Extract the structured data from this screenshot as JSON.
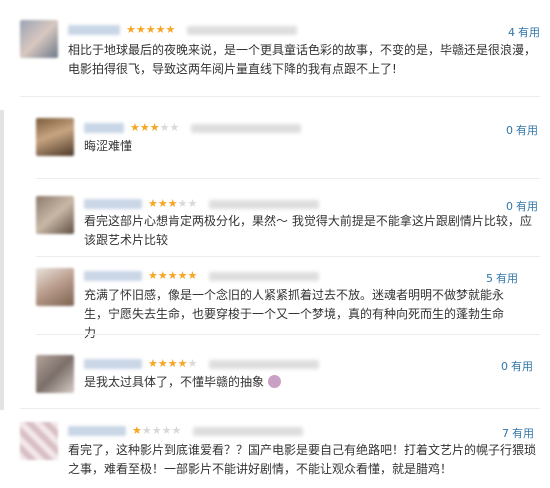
{
  "reviews": [
    {
      "stars": 5,
      "useful_count": "4",
      "useful_label": "有用",
      "text": "相比于地球最后的夜晚来说，是一个更具童话色彩的故事，不变的是，毕赣还是很浪漫，电影拍得很飞，导致这两年阅片量直线下降的我有点跟不上了!"
    },
    {
      "stars": 3,
      "useful_count": "0",
      "useful_label": "有用",
      "text": "晦涩难懂"
    },
    {
      "stars": 3,
      "useful_count": "0",
      "useful_label": "有用",
      "text": "看完这部片心想肯定两极分化，果然～ 我觉得大前提是不能拿这片跟剧情片比较，应该跟艺术片比较"
    },
    {
      "stars": 5,
      "useful_count": "5",
      "useful_label": "有用",
      "text": "充满了怀旧感，像是一个念旧的人紧紧抓着过去不放。迷魂者明明不做梦就能永生，宁愿失去生命，也要穿梭于一个又一个梦境，真的有种向死而生的蓬勃生命力"
    },
    {
      "stars": 4,
      "useful_count": "0",
      "useful_label": "有用",
      "text": "是我太过具体了，不懂毕赣的抽象"
    },
    {
      "stars": 1,
      "useful_count": "7",
      "useful_label": "有用",
      "text": "看完了，这种影片到底谁爱看？？国产电影是要自己有绝路吧！打着文艺片的幌子行猥琐之事，难看至极！一部影片不能讲好剧情，不能让观众看懂，就是腊鸡！"
    }
  ],
  "colors": {
    "star_on": "#f6a623",
    "link": "#3377aa"
  }
}
